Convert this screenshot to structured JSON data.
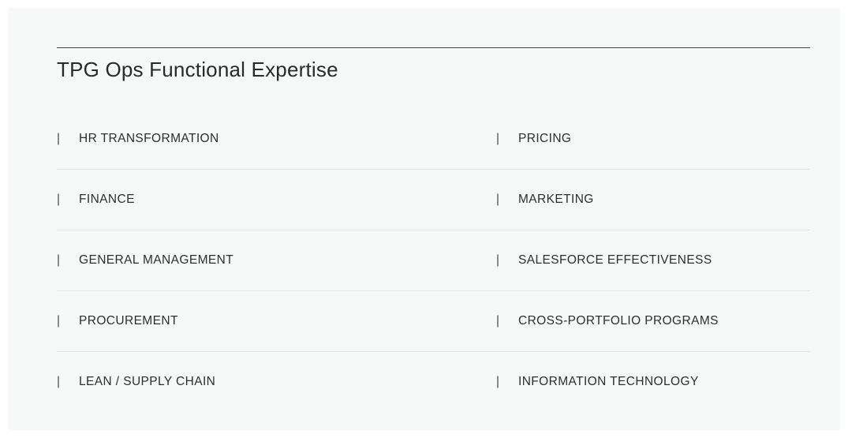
{
  "section": {
    "title": "TPG Ops Functional Expertise"
  },
  "separator_glyph": "|",
  "rows": [
    {
      "left": "HR TRANSFORMATION",
      "right": "PRICING"
    },
    {
      "left": "FINANCE",
      "right": "MARKETING"
    },
    {
      "left": "GENERAL MANAGEMENT",
      "right": "SALESFORCE EFFECTIVENESS"
    },
    {
      "left": "PROCUREMENT",
      "right": "CROSS-PORTFOLIO PROGRAMS"
    },
    {
      "left": "LEAN / SUPPLY CHAIN",
      "right": "INFORMATION TECHNOLOGY"
    }
  ]
}
